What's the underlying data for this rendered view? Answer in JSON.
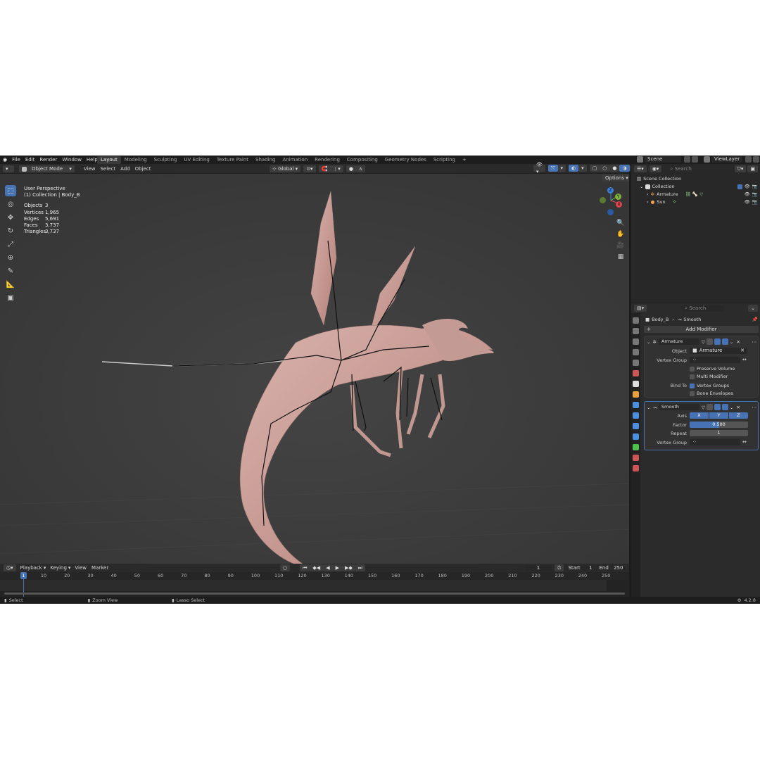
{
  "topbar": {
    "menu": [
      "File",
      "Edit",
      "Render",
      "Window",
      "Help"
    ],
    "workspaces": [
      "Layout",
      "Modeling",
      "Sculpting",
      "UV Editing",
      "Texture Paint",
      "Shading",
      "Animation",
      "Rendering",
      "Compositing",
      "Geometry Nodes",
      "Scripting",
      "+"
    ],
    "active_workspace": "Layout",
    "scene": "Scene",
    "view_layer": "ViewLayer"
  },
  "viewport_header": {
    "mode": "Object Mode",
    "menus": [
      "View",
      "Select",
      "Add",
      "Object"
    ],
    "transform_orientation": "Global",
    "options": "Options"
  },
  "viewport": {
    "view_name": "User Perspective",
    "collection_path": "(1) Collection | Body_B",
    "stats": [
      {
        "label": "Objects",
        "value": "3"
      },
      {
        "label": "Vertices",
        "value": "1,965"
      },
      {
        "label": "Edges",
        "value": "5,691"
      },
      {
        "label": "Faces",
        "value": "3,737"
      },
      {
        "label": "Triangles",
        "value": "3,737"
      }
    ],
    "gizmo_axes": {
      "x": "X",
      "y": "Y",
      "z": "Z"
    },
    "colors": {
      "background": "#3d3d3d",
      "mesh": "#c9a09a",
      "x_axis": "#e0444f",
      "y_axis": "#7fb23a",
      "z_axis": "#3b82e0"
    }
  },
  "timeline": {
    "menus": [
      "Playback",
      "Keying",
      "View",
      "Marker"
    ],
    "current_frame": "1",
    "start_label": "Start",
    "start": "1",
    "end_label": "End",
    "end": "250",
    "ticks": [
      "1",
      "10",
      "20",
      "30",
      "40",
      "50",
      "60",
      "70",
      "80",
      "90",
      "100",
      "110",
      "120",
      "130",
      "140",
      "150",
      "160",
      "170",
      "180",
      "190",
      "200",
      "210",
      "220",
      "230",
      "240",
      "250"
    ]
  },
  "statusbar": {
    "select": "Select",
    "zoom_view": "Zoom View",
    "lasso_select": "Lasso Select",
    "version": "4.2.8"
  },
  "outliner": {
    "search_placeholder": "Search",
    "scene_collection": "Scene Collection",
    "collection": "Collection",
    "items": [
      "Armature",
      "Sun"
    ]
  },
  "properties": {
    "search_placeholder": "Search",
    "breadcrumb_object": "Body_B",
    "breadcrumb_modifier": "Smooth",
    "add_modifier": "Add Modifier",
    "armature_mod": {
      "name": "Armature",
      "object_label": "Object",
      "object_value": "Armature",
      "vertex_group_label": "Vertex Group",
      "preserve_volume": "Preserve Volume",
      "multi_modifier": "Multi Modifier",
      "bind_to_label": "Bind To",
      "vertex_groups": "Vertex Groups",
      "bone_envelopes": "Bone Envelopes"
    },
    "smooth_mod": {
      "name": "Smooth",
      "axis_label": "Axis",
      "axes": [
        "X",
        "Y",
        "Z"
      ],
      "factor_label": "Factor",
      "factor_value": "0.500",
      "repeat_label": "Repeat",
      "repeat_value": "1",
      "vertex_group_label": "Vertex Group"
    }
  }
}
